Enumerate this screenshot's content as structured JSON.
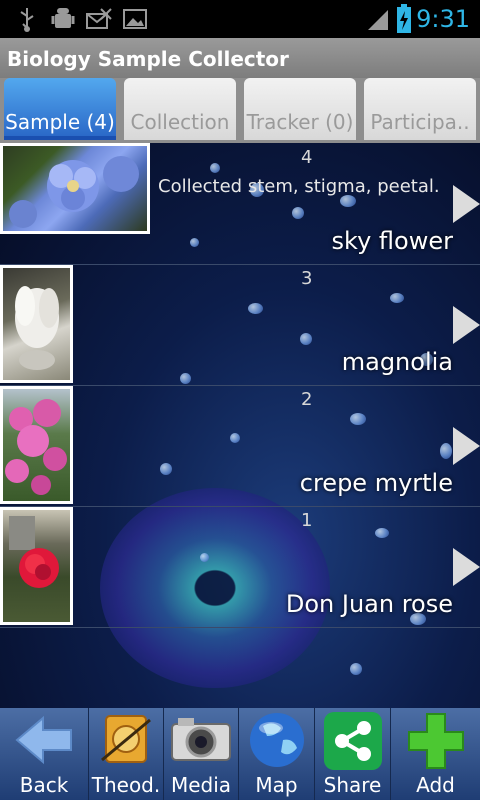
{
  "status_bar": {
    "time": "9:31",
    "icons": [
      "usb-icon",
      "android-debug-icon",
      "missed-message-icon",
      "image-icon",
      "signal-icon",
      "battery-charging-icon"
    ]
  },
  "app": {
    "title": "Biology Sample Collector"
  },
  "tabs": [
    {
      "label": "Sample (4)",
      "active": true
    },
    {
      "label": "Collection",
      "active": false
    },
    {
      "label": "Tracker (0)",
      "active": false
    },
    {
      "label": "Participa..",
      "active": false
    }
  ],
  "samples": [
    {
      "number": "4",
      "description": "Collected stem, stigma, peetal.",
      "name": "sky flower"
    },
    {
      "number": "3",
      "description": "",
      "name": "magnolia"
    },
    {
      "number": "2",
      "description": "",
      "name": "crepe myrtle"
    },
    {
      "number": "1",
      "description": "",
      "name": "Don Juan rose"
    }
  ],
  "toolbar": {
    "back": "Back",
    "theod": "Theod.",
    "media": "Media",
    "map": "Map",
    "share": "Share",
    "add": "Add"
  },
  "colors": {
    "accent": "#2fb6e6",
    "active_tab": "#2b69c8",
    "toolbar": "#1f3d74"
  }
}
